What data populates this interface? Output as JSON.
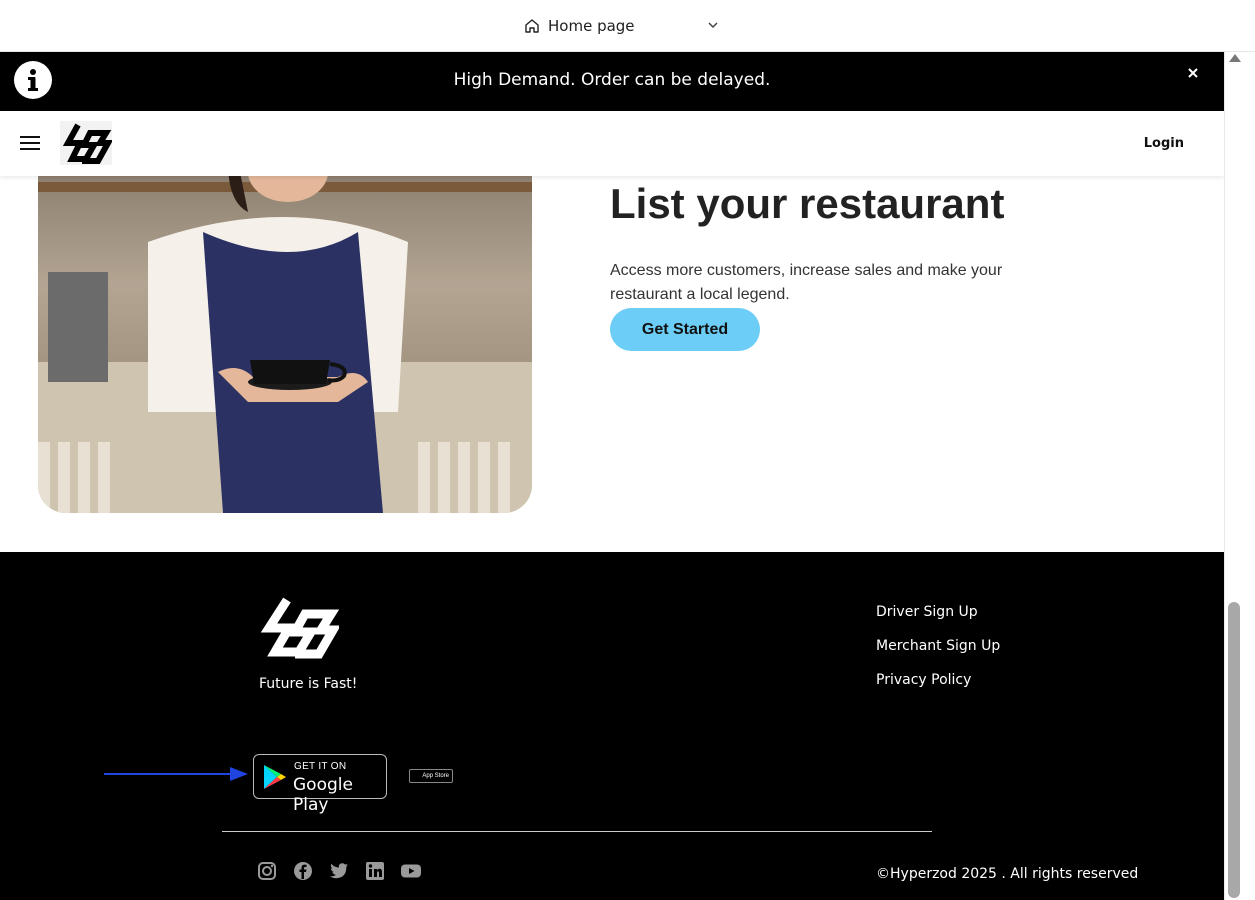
{
  "browser": {
    "page_select_label": "Home page"
  },
  "banner": {
    "message": "High Demand. Order can be delayed."
  },
  "header": {
    "login_label": "Login"
  },
  "hero": {
    "title": "List your restaurant",
    "description": "Access more customers, increase sales and make your restaurant a local legend.",
    "cta_label": "Get Started"
  },
  "footer": {
    "tagline": "Future is Fast!",
    "links": [
      "Driver Sign Up",
      "Merchant Sign Up",
      "Privacy Policy"
    ],
    "google_play_small": "GET IT ON",
    "google_play_big": "Google Play",
    "app_store_label": "App Store",
    "copyright": "©Hyperzod 2025 . All rights reserved",
    "social_icons": [
      "instagram-icon",
      "facebook-icon",
      "twitter-icon",
      "linkedin-icon",
      "youtube-icon"
    ]
  },
  "colors": {
    "cta": "#6ccdf6",
    "footer_bg": "#000000",
    "arrow": "#1f44e0"
  }
}
